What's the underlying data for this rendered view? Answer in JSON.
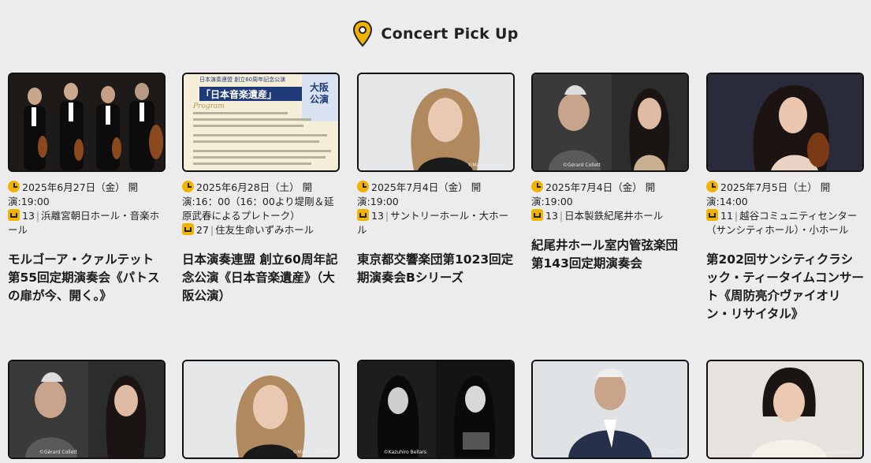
{
  "header": {
    "title": "Concert Pick Up",
    "icon": "map-pin-icon",
    "icon_color": "#f0b400"
  },
  "concerts": [
    {
      "date": "2025年6月27日（金） 開演:19:00",
      "count": "13",
      "venue": "浜離宮朝日ホール・音楽ホール",
      "title": "モルゴーア・クァルテット第55回定期演奏会《パトスの扉が今、開く。》",
      "credit": ""
    },
    {
      "date": "2025年6月28日（土） 開演:16：00（16：00より堤剛＆延原武春によるプレトーク）",
      "count": "27",
      "venue": "住友生命いずみホール",
      "title": "日本演奏連盟 創立60周年記念公演《日本音楽遺産》（大阪公演）",
      "credit": "",
      "poster": {
        "heading": "日本演奏連盟 創立60周年記念公演",
        "main": "「日本音楽遺産」",
        "badge": "大阪公演",
        "program": "Program"
      }
    },
    {
      "date": "2025年7月4日（金） 開演:19:00",
      "count": "13",
      "venue": "サントリーホール・大ホール",
      "title": "東京都交響楽団第1023回定期演奏会Bシリーズ",
      "credit": "©Mathias Bothor"
    },
    {
      "date": "2025年7月4日（金） 開演:19:00",
      "count": "13",
      "venue": "日本製鉄紀尾井ホール",
      "title": "紀尾井ホール室内管弦楽団第143回定期演奏会",
      "credit": "©Gérard Collett"
    },
    {
      "date": "2025年7月5日（土） 開演:14:00",
      "count": "11",
      "venue": "越谷コミュニティセンター（サンシティホール）・小ホール",
      "title": "第202回サンシティクラシック・ティータイムコンサート《周防亮介ヴァイオリン・リサイタル》",
      "credit": ""
    },
    {
      "credit": "©Gérard Collett"
    },
    {
      "credit": "©Mathias Bothor"
    },
    {
      "credit": "©Kazuhiro Bellars"
    },
    {
      "credit": "©K.Miura"
    },
    {
      "credit": "©Fukumoto/MOC"
    }
  ]
}
